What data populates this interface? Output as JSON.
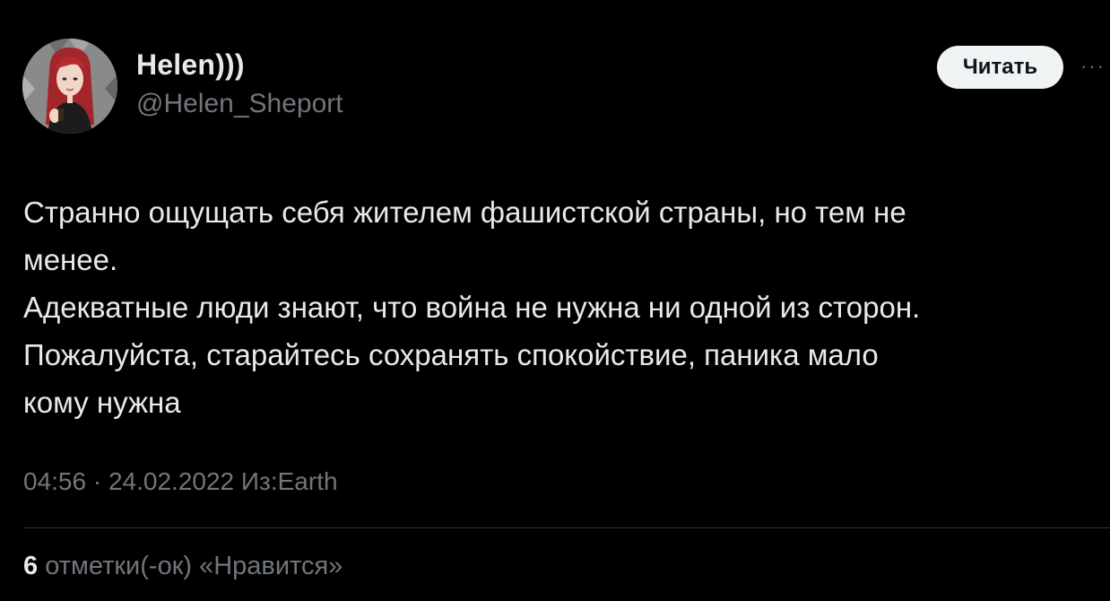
{
  "author": {
    "display_name": "Helen)))",
    "handle": "@Helen_Sheport"
  },
  "actions": {
    "follow_label": "Читать",
    "more_icon": "more-dots-icon"
  },
  "tweet": {
    "lines": [
      "Странно ощущать себя жителем фашистской страны, но тем не",
      "менее.",
      "Адекватные люди знают, что война не нужна ни одной из сторон.",
      "Пожалуйста, старайтесь сохранять спокойствие, паника мало",
      "кому нужна"
    ],
    "time": "04:56",
    "separator": "·",
    "date": "24.02.2022",
    "source": "Из:Earth"
  },
  "engagement": {
    "likes_count": "6",
    "likes_label": "отметки(-ок) «Нравится»"
  },
  "colors": {
    "background": "#000000",
    "text_primary": "#e7e9ea",
    "text_secondary": "#71767b",
    "button_bg": "#eff3f4",
    "avatar_hair": "#a3262a"
  }
}
